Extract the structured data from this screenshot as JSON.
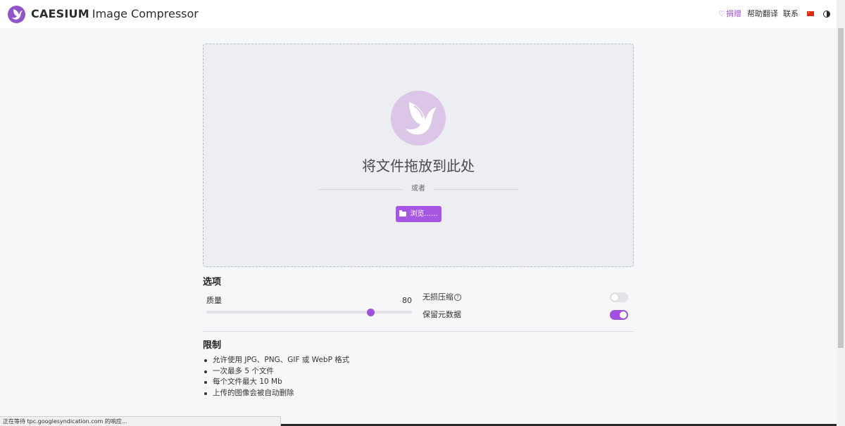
{
  "header": {
    "brand_bold": "CAESIUM",
    "brand_rest": "Image Compressor",
    "nav": {
      "donate": "捐赠",
      "translate": "帮助翻译",
      "contact": "联系"
    },
    "language_flag": "cn-flag-icon",
    "theme_icon": "half-circle-icon"
  },
  "dropzone": {
    "title": "将文件拖放到此处",
    "or": "或者",
    "browse_label": "浏览......"
  },
  "options": {
    "title": "选项",
    "quality_label": "质量",
    "quality_value": "80",
    "quality_level": 80,
    "lossless_label": "无损压缩",
    "lossless_enabled": false,
    "keep_metadata_label": "保留元数据",
    "keep_metadata_enabled": true
  },
  "limits": {
    "title": "限制",
    "items": [
      "允许使用 JPG、PNG、GIF 或 WebP 格式",
      "一次最多 5 个文件",
      "每个文件最大 10 Mb",
      "上传的图像会被自动删除"
    ]
  },
  "status_bar": {
    "text": "正在等待 tpc.googlesyndication.com 的响应..."
  },
  "colors": {
    "accent": "#a756e3",
    "logo": "#8f55c9",
    "background": "#f6f7f9"
  }
}
